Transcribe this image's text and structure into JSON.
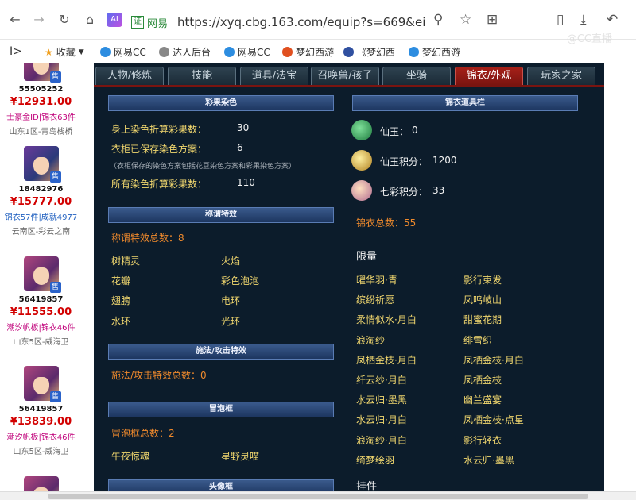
{
  "browser": {
    "back_icon": "arrow-left-icon",
    "url_site_tag": "网易",
    "url": "https://xyq.cbg.163.com/equip?s=669&ei",
    "secure_badge": "证"
  },
  "bookmarks": [
    {
      "label": "收藏",
      "icon": "star-icon",
      "color": "#f0a020"
    },
    {
      "label": "网易CC",
      "icon": "cc-icon",
      "color": "#2d8de0"
    },
    {
      "label": "达人后台",
      "icon": "gear-icon",
      "color": "#888888"
    },
    {
      "label": "网易CC",
      "icon": "cc-icon",
      "color": "#2d8de0"
    },
    {
      "label": "梦幻西游",
      "icon": "game-icon",
      "color": "#e05020"
    },
    {
      "label": "《梦幻西",
      "icon": "game-icon",
      "color": "#3050a0"
    },
    {
      "label": "梦幻西游",
      "icon": "cc-icon",
      "color": "#2d8de0"
    }
  ],
  "watermark": "@CC直播",
  "sidebar": {
    "sellers": [
      {
        "id": "55505252",
        "price": "¥12931.00",
        "tags": "士豪金ID|锦衣63件",
        "server": "山东1区-青岛栈桥"
      },
      {
        "id": "18482976",
        "price": "¥15777.00",
        "tags": "锦衣57件|成就4977",
        "server": "云南区-彩云之南"
      },
      {
        "id": "56419857",
        "price": "¥11555.00",
        "tags": "潮汐帆板|锦衣46件",
        "server": "山东5区-威海卫"
      },
      {
        "id": "56419857",
        "price": "¥13839.00",
        "tags": "潮汐帆板|锦衣46件",
        "server": "山东5区-威海卫"
      }
    ],
    "sell_badge": "售"
  },
  "tabs": [
    "人物/修炼",
    "技能",
    "道具/法宝",
    "召唤兽/孩子",
    "坐骑",
    "锦衣/外观",
    "玩家之家"
  ],
  "active_tab": 5,
  "left": {
    "dye": {
      "title": "彩果染色",
      "rows": [
        {
          "label": "身上染色折算彩果数：",
          "value": "30"
        },
        {
          "label": "衣柜已保存染色方案：",
          "value": "6"
        },
        {
          "label": "所有染色折算彩果数：",
          "value": "110"
        }
      ],
      "note": "（衣柜保存的染色方案包括花豆染色方案和彩果染色方案）"
    },
    "title_fx": {
      "title": "称谓特效",
      "total": "称谓特效总数：8",
      "items": [
        "树精灵",
        "火焰",
        "花瓣",
        "彩色泡泡",
        "翅膀",
        "电环",
        "水环",
        "光环"
      ]
    },
    "cast_fx": {
      "title": "施法/攻击特效",
      "total": "施法/攻击特效总数：0"
    },
    "bubble": {
      "title": "冒泡框",
      "total": "冒泡框总数：2",
      "items": [
        "午夜惊魂",
        "星野灵喵"
      ]
    },
    "next_title": "头像框"
  },
  "right": {
    "title": "锦衣道具栏",
    "currencies": [
      {
        "label": "仙玉：",
        "value": "0",
        "icon": "jade-icon",
        "color": "#2a9a50"
      },
      {
        "label": "仙玉积分：",
        "value": "1200",
        "icon": "jade-points-icon",
        "color": "#e0b040"
      },
      {
        "label": "七彩积分：",
        "value": "33",
        "icon": "rainbow-points-icon",
        "color": "#e08a60"
      }
    ],
    "total": "锦衣总数：55",
    "limited_title": "限量",
    "limited": [
      "曜华羽·青",
      "影行束发",
      "缤纷祈愿",
      "凤鸣岐山",
      "柔情似水·月白",
      "甜蜜花期",
      "浪淘纱",
      "绯雪织",
      "凤栖金枝·月白",
      "凤栖金枝·月白",
      "纤云纱·月白",
      "凤栖金枝",
      "水云归·墨黑",
      "幽兰盛宴",
      "水云归·月白",
      "凤栖金枝·点星",
      "浪淘纱·月白",
      "影行轻衣",
      "绮梦绘羽",
      "水云归·墨黑"
    ],
    "next_title": "挂件"
  }
}
